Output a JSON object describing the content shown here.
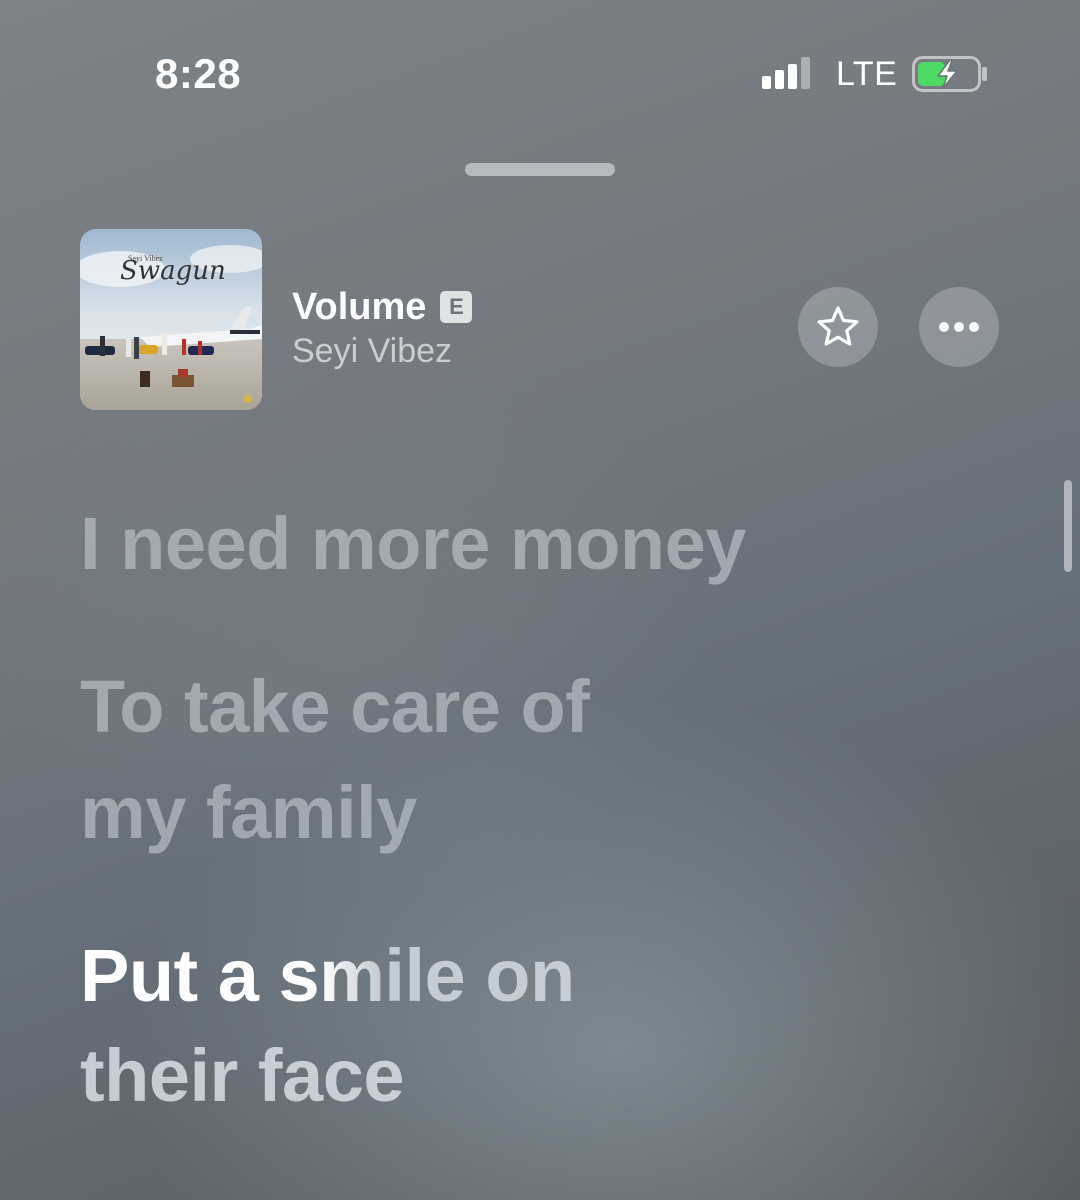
{
  "status_bar": {
    "time": "8:28",
    "network": "LTE",
    "signal_bars_active": 3,
    "signal_bars_total": 4,
    "battery_state": "charging"
  },
  "now_playing": {
    "artwork": {
      "artist_text": "Seyi Vibez",
      "album_text": "Swagun"
    },
    "title": "Volume",
    "explicit_badge": "E",
    "artist": "Seyi Vibez",
    "favorite_icon": "star-icon",
    "more_icon": "ellipsis-icon"
  },
  "lyrics": {
    "past": [
      {
        "lines": [
          "I need more money"
        ]
      },
      {
        "lines": [
          "To take care of",
          "my family"
        ]
      }
    ],
    "current": {
      "lines": [
        "Put a smile on",
        "their face"
      ]
    }
  },
  "colors": {
    "battery_fill": "#4cd964",
    "background_top": "#7d8286",
    "background_bottom": "#5a5d60"
  }
}
